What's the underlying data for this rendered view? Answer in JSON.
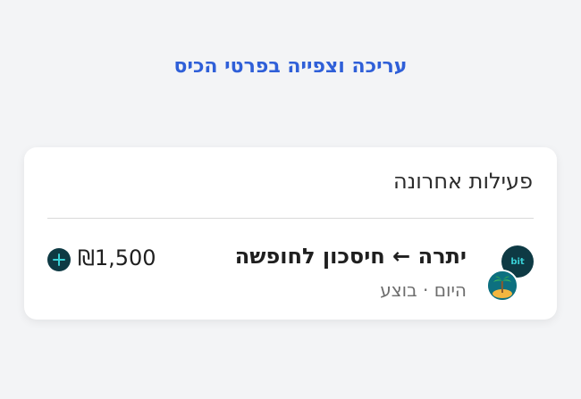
{
  "header": {
    "edit_link": "עריכה וצפייה בפרטי הכיס"
  },
  "activity": {
    "title": "פעילות אחרונה",
    "transactions": [
      {
        "title": "יתרה ← חיסכון לחופשה",
        "subtitle": "היום · בוצע",
        "amount": "₪1,500",
        "source_icon": "bit-icon",
        "source_label": "bit",
        "target_icon": "palm-tree-icon",
        "direction_icon": "plus-icon"
      }
    ]
  },
  "colors": {
    "link": "#2f5fd8",
    "bit_background": "#0e3a44",
    "bit_text": "#39d1d6",
    "pocket_background": "#0d7080"
  }
}
